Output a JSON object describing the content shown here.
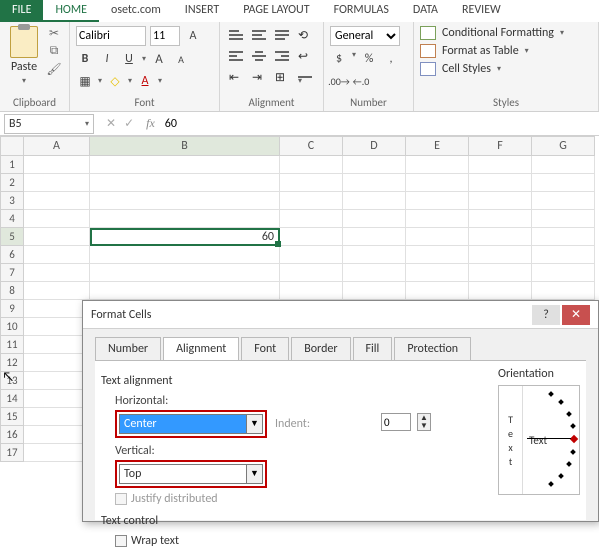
{
  "tabs": {
    "file": "FILE",
    "home": "HOME",
    "osetc": "osetc.com",
    "insert": "INSERT",
    "pagelayout": "PAGE LAYOUT",
    "formulas": "FORMULAS",
    "data": "DATA",
    "review": "REVIEW"
  },
  "ribbon": {
    "clipboard": {
      "paste": "Paste",
      "label": "Clipboard"
    },
    "font": {
      "name": "Calibri",
      "size": "11",
      "label": "Font"
    },
    "alignment": {
      "label": "Alignment"
    },
    "number": {
      "format": "General",
      "label": "Number"
    },
    "styles": {
      "cond": "Conditional Formatting",
      "table": "Format as Table",
      "cell": "Cell Styles",
      "label": "Styles"
    }
  },
  "formulabar": {
    "name": "B5",
    "fx": "fx",
    "value": "60"
  },
  "cols": [
    "A",
    "B",
    "C",
    "D",
    "E",
    "F",
    "G"
  ],
  "rows": [
    "1",
    "2",
    "3",
    "4",
    "5",
    "6",
    "7",
    "8",
    "9",
    "10",
    "11",
    "12",
    "13",
    "14",
    "15",
    "16",
    "17"
  ],
  "cellB5": "60",
  "dialog": {
    "title": "Format Cells",
    "tabs": {
      "number": "Number",
      "alignment": "Alignment",
      "font": "Font",
      "border": "Border",
      "fill": "Fill",
      "protection": "Protection"
    },
    "sec_textalign": "Text alignment",
    "lbl_horizontal": "Horizontal:",
    "val_horizontal": "Center",
    "lbl_indent": "Indent:",
    "val_indent": "0",
    "lbl_vertical": "Vertical:",
    "val_vertical": "Top",
    "chk_justify": "Justify distributed",
    "sec_textcontrol": "Text control",
    "chk_wrap": "Wrap text",
    "orient_label": "Orientation",
    "orient_text": "Text",
    "orient_vchars": [
      "T",
      "e",
      "x",
      "t"
    ]
  }
}
